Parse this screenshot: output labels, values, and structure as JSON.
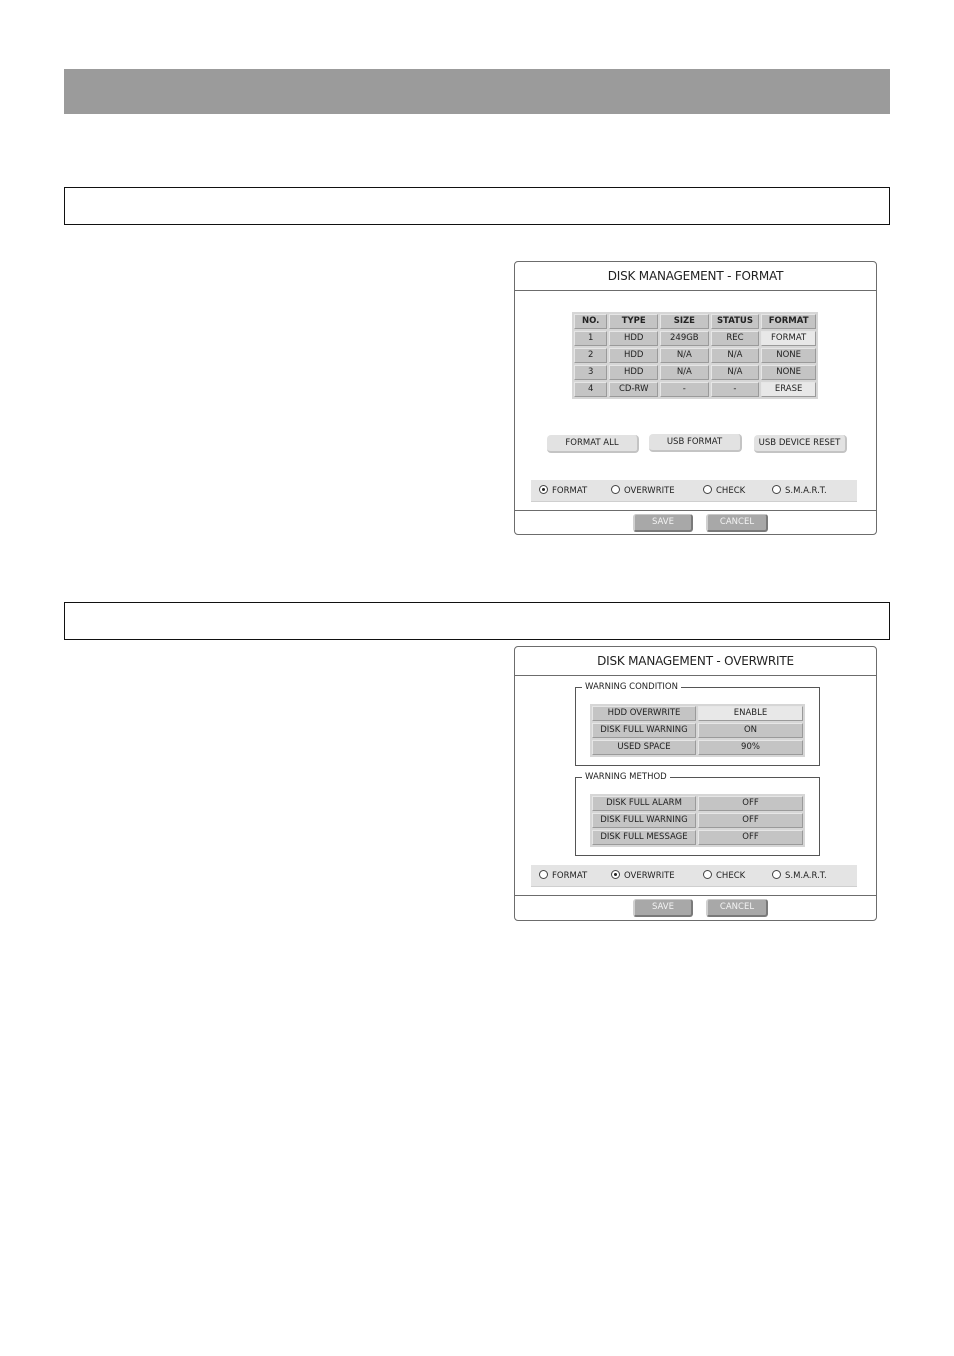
{
  "format_dialog": {
    "title": "DISK MANAGEMENT - FORMAT",
    "table": {
      "headers": [
        "NO.",
        "TYPE",
        "SIZE",
        "STATUS",
        "FORMAT"
      ],
      "rows": [
        [
          "1",
          "HDD",
          "249GB",
          "REC",
          "FORMAT"
        ],
        [
          "2",
          "HDD",
          "N/A",
          "N/A",
          "NONE"
        ],
        [
          "3",
          "HDD",
          "N/A",
          "N/A",
          "NONE"
        ],
        [
          "4",
          "CD-RW",
          "-",
          "-",
          "ERASE"
        ]
      ]
    },
    "buttons": {
      "format_all": "FORMAT ALL",
      "usb_format": "USB FORMAT",
      "usb_device_reset": "USB DEVICE RESET"
    },
    "tabs": {
      "selected": "FORMAT",
      "items": [
        "FORMAT",
        "OVERWRITE",
        "CHECK",
        "S.M.A.R.T."
      ]
    },
    "footer": {
      "save": "SAVE",
      "cancel": "CANCEL"
    }
  },
  "overwrite_dialog": {
    "title": "DISK MANAGEMENT - OVERWRITE",
    "warning_condition": {
      "legend": "WARNING CONDITION",
      "rows": [
        {
          "label": "HDD OVERWRITE",
          "value": "ENABLE"
        },
        {
          "label": "DISK FULL WARNING",
          "value": "ON"
        },
        {
          "label": "USED SPACE",
          "value": "90%"
        }
      ]
    },
    "warning_method": {
      "legend": "WARNING METHOD",
      "rows": [
        {
          "label": "DISK FULL ALARM",
          "value": "OFF"
        },
        {
          "label": "DISK FULL WARNING",
          "value": "OFF"
        },
        {
          "label": "DISK FULL MESSAGE",
          "value": "OFF"
        }
      ]
    },
    "tabs": {
      "selected": "OVERWRITE",
      "items": [
        "FORMAT",
        "OVERWRITE",
        "CHECK",
        "S.M.A.R.T."
      ]
    },
    "footer": {
      "save": "SAVE",
      "cancel": "CANCEL"
    }
  }
}
